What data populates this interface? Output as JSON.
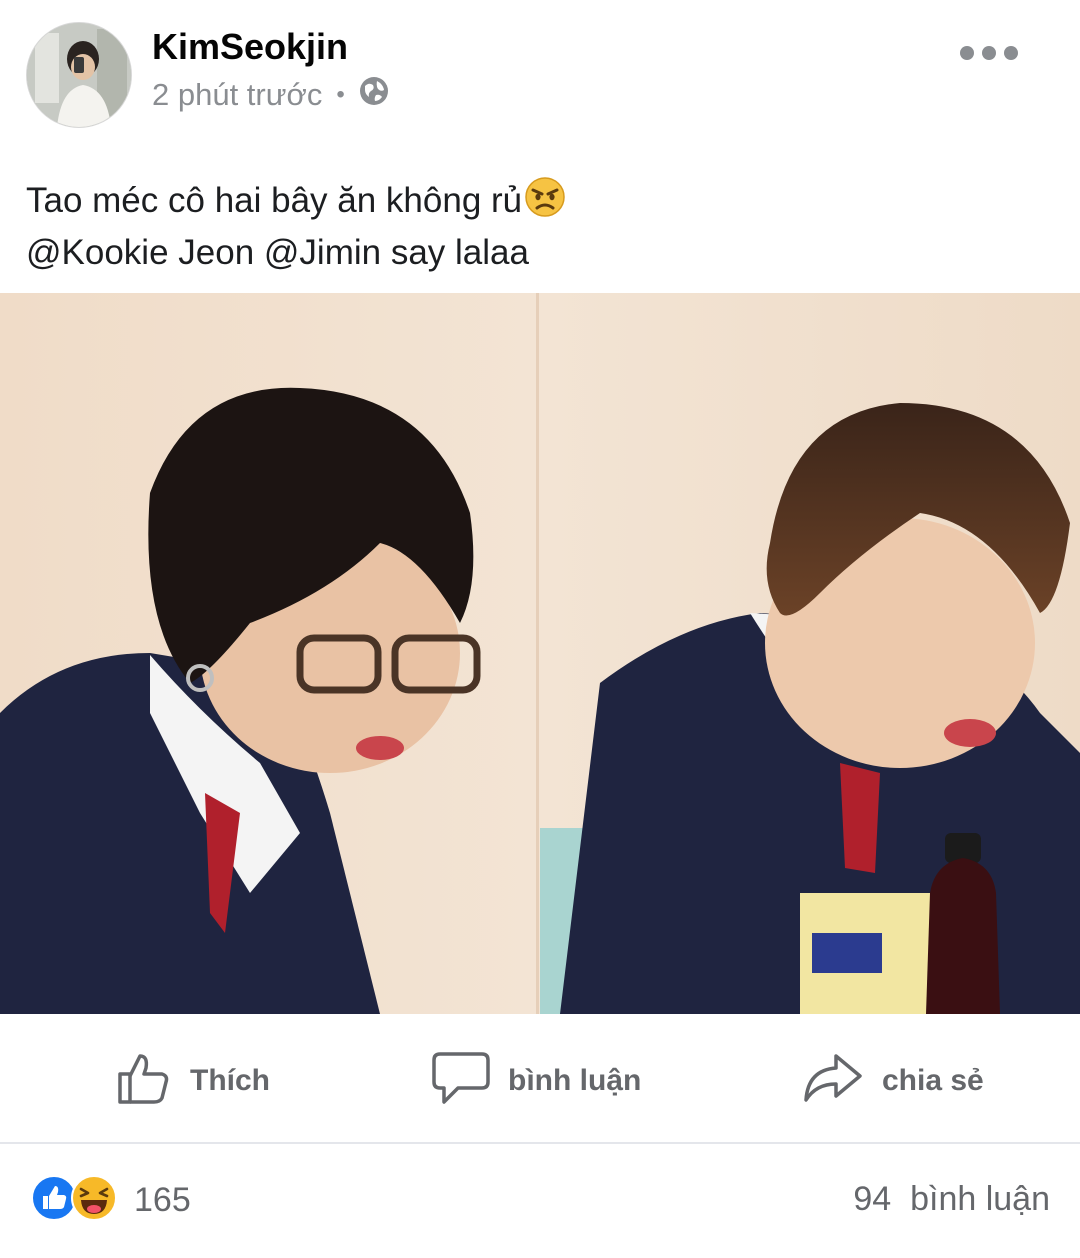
{
  "post": {
    "author": "KimSeokjin",
    "time": "2 phút trước",
    "separator": "•",
    "privacy_icon": "globe-icon",
    "caption_line1": "Tao méc cô hai bây ăn không rủ",
    "caption_emoji": "angry-face-emoji",
    "caption_line2": "@Kookie Jeon @Jimin say lalaa"
  },
  "actions": {
    "like": "Thích",
    "comment": "bình luận",
    "share": "chia sẻ"
  },
  "stats": {
    "reaction_icons": [
      "like-reaction-icon",
      "haha-reaction-icon"
    ],
    "reactions_count": "165",
    "comments_count": "94  bình luận"
  },
  "colors": {
    "like_blue": "#1877f2",
    "haha_yellow": "#f7b928",
    "muted_text": "#65676b"
  }
}
